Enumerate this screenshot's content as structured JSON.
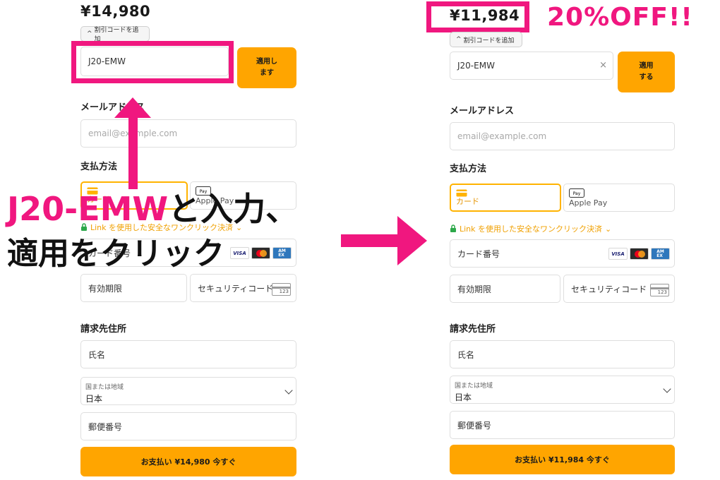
{
  "before": {
    "price": "¥14,980",
    "discount_toggle": "割引コードを追加",
    "code_value": "J20-EMW",
    "apply_label_1": "適用し",
    "apply_label_2": "ます",
    "email_label": "メールアドレス",
    "email_placeholder": "email@example.com",
    "payment_label": "支払方法",
    "card_tab": "カード",
    "applepay_tab": "Apple Pay",
    "link_text": "Link を使用した安全なワンクリック決済",
    "card_number": "カード番号",
    "expiry": "有効期限",
    "security_code": "セキュリティコード",
    "billing_label": "請求先住所",
    "name_field": "氏名",
    "country_small": "国または地域",
    "country_value": "日本",
    "postal": "郵便番号",
    "pay_button": "お支払い ¥14,980 今すぐ"
  },
  "after": {
    "price": "¥11,984",
    "discount_toggle": "割引コードを追加",
    "code_value": "J20-EMW",
    "apply_label_1": "適用",
    "apply_label_2": "する",
    "email_label": "メールアドレス",
    "email_placeholder": "email@example.com",
    "payment_label": "支払方法",
    "card_tab": "カード",
    "applepay_tab": "Apple Pay",
    "link_text": "Link を使用した安全なワンクリック決済",
    "card_number": "カード番号",
    "expiry": "有効期限",
    "security_code": "セキュリティコード",
    "billing_label": "請求先住所",
    "name_field": "氏名",
    "country_small": "国または地域",
    "country_value": "日本",
    "postal": "郵便番号",
    "pay_button": "お支払い ¥11,984 今すぐ"
  },
  "annotations": {
    "off": "20%OFF!!",
    "instruction_line1_code": "J20-EMW",
    "instruction_line1_rest": "と入力、",
    "instruction_line2": "適用をクリック"
  },
  "colors": {
    "accent": "#ffa500",
    "highlight": "#f0177f",
    "link": "#f0a000"
  },
  "icons": {
    "card": "card-icon",
    "applepay": "apple-pay-icon",
    "lock": "lock-icon",
    "clear": "clear-icon",
    "chevron": "chevron-down-icon"
  }
}
